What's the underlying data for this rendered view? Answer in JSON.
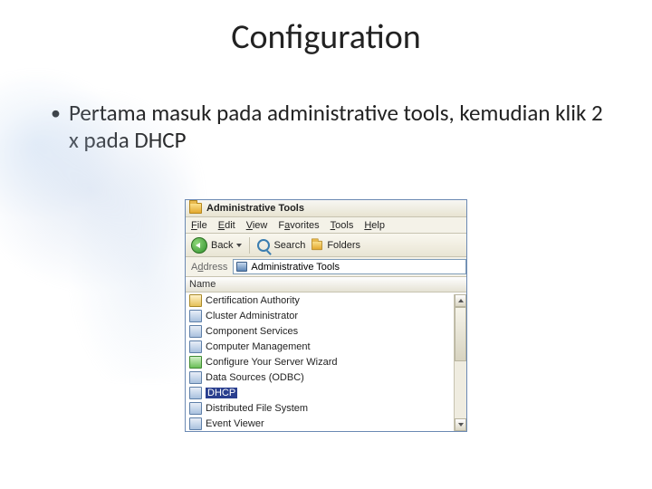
{
  "slide": {
    "title": "Configuration",
    "bullet": "Pertama masuk pada administrative tools, kemudian klik 2 x pada DHCP"
  },
  "explorer": {
    "title": "Administrative Tools",
    "menu": {
      "file": "File",
      "edit": "Edit",
      "view": "View",
      "favorites": "Favorites",
      "tools": "Tools",
      "help": "Help"
    },
    "toolbar": {
      "back": "Back",
      "search": "Search",
      "folders": "Folders"
    },
    "address": {
      "label": "Address",
      "value": "Administrative Tools"
    },
    "column_header": "Name",
    "items": [
      {
        "label": "Certification Authority",
        "icon": "yellow",
        "selected": false,
        "name": "item-certification-authority"
      },
      {
        "label": "Cluster Administrator",
        "icon": "blue",
        "selected": false,
        "name": "item-cluster-administrator"
      },
      {
        "label": "Component Services",
        "icon": "blue",
        "selected": false,
        "name": "item-component-services"
      },
      {
        "label": "Computer Management",
        "icon": "blue",
        "selected": false,
        "name": "item-computer-management"
      },
      {
        "label": "Configure Your Server Wizard",
        "icon": "green",
        "selected": false,
        "name": "item-configure-your-server-wizard"
      },
      {
        "label": "Data Sources (ODBC)",
        "icon": "blue",
        "selected": false,
        "name": "item-data-sources-odbc"
      },
      {
        "label": "DHCP",
        "icon": "blue",
        "selected": true,
        "name": "item-dhcp"
      },
      {
        "label": "Distributed File System",
        "icon": "blue",
        "selected": false,
        "name": "item-distributed-file-system"
      },
      {
        "label": "Event Viewer",
        "icon": "blue",
        "selected": false,
        "name": "item-event-viewer"
      }
    ]
  }
}
